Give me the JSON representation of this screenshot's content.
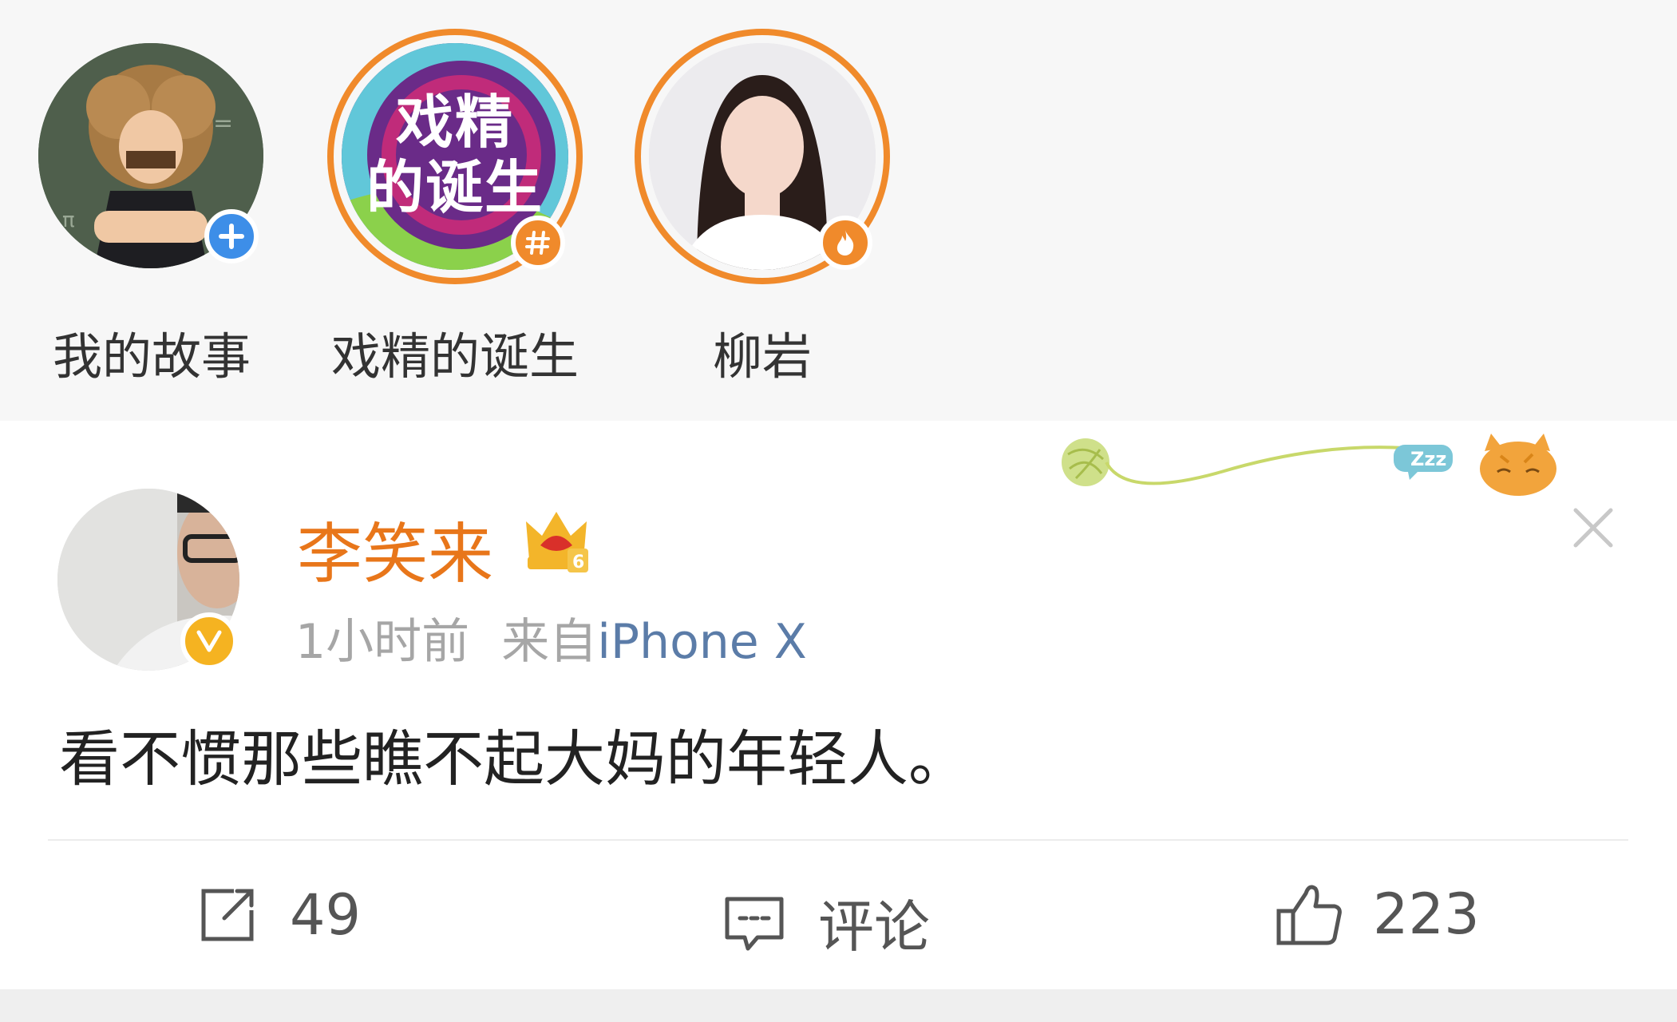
{
  "stories": [
    {
      "name": "我的故事",
      "badge": "add-icon"
    },
    {
      "name": "戏精的诞生",
      "badge": "hashtag-icon",
      "cover_line1": "戏精",
      "cover_line2": "的诞生"
    },
    {
      "name": "柳岩",
      "badge": "fire-icon"
    }
  ],
  "post": {
    "author": "李笑来",
    "crown_level": "6",
    "time": "1小时前",
    "source_prefix": "来自",
    "source_device": "iPhone X",
    "content": "看不惯那些瞧不起大妈的年轻人。",
    "actions": {
      "repost_count": "49",
      "comment_label": "评论",
      "like_count": "223"
    }
  },
  "colors": {
    "author_name": "#e8761a",
    "ring": "#f08a2b",
    "verified": "#f5b321",
    "source_link": "#5b7ca8",
    "add_badge": "#3d8ee8"
  }
}
